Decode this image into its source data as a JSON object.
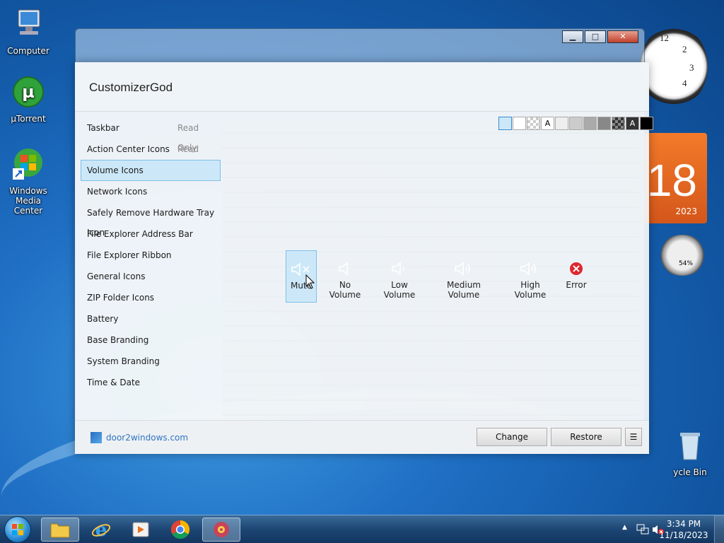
{
  "desktop": {
    "icons": [
      {
        "label": "Computer",
        "icon": "computer-icon"
      },
      {
        "label": "µTorrent",
        "icon": "utorrent-icon"
      },
      {
        "label": "Windows Media Center",
        "icon": "windows-media-center-icon"
      },
      {
        "label": "ycle Bin",
        "icon": "recycle-bin-icon"
      }
    ]
  },
  "gadgets": {
    "clock": {
      "numerals": [
        "12",
        "2",
        "3",
        "4"
      ]
    },
    "calendar": {
      "day": "18",
      "year": "2023",
      "accent": "#e8651f"
    },
    "cpu_meter": {
      "percent": "54%"
    }
  },
  "customizer": {
    "title": "CustomizerGod",
    "sidebar": [
      {
        "label": "Taskbar",
        "status": "Read Only"
      },
      {
        "label": "Action Center Icons",
        "status": "Read Only"
      },
      {
        "label": "Volume Icons",
        "status": ""
      },
      {
        "label": "Network Icons",
        "status": ""
      },
      {
        "label": "Safely Remove Hardware Tray Icon",
        "status": ""
      },
      {
        "label": "File Explorer Address Bar",
        "status": ""
      },
      {
        "label": "File Explorer Ribbon",
        "status": ""
      },
      {
        "label": "General Icons",
        "status": ""
      },
      {
        "label": "ZIP Folder Icons",
        "status": ""
      },
      {
        "label": "Battery",
        "status": ""
      },
      {
        "label": "Base Branding",
        "status": ""
      },
      {
        "label": "System Branding",
        "status": ""
      },
      {
        "label": "Time & Date",
        "status": ""
      }
    ],
    "selected_index": 2,
    "swatch_letters": [
      "A",
      "A"
    ],
    "volume_items": [
      "Mute",
      "No Volume",
      "Low Volume",
      "Medium Volume",
      "High Volume",
      "Error"
    ],
    "footer": {
      "brand": "door2windows.com",
      "change_label": "Change",
      "restore_label": "Restore",
      "menu_label": "☰"
    },
    "accent": "#cce8f8",
    "error_color": "#e0262c"
  },
  "taskbar": {
    "time": "3:34 PM",
    "date": "11/18/2023"
  }
}
